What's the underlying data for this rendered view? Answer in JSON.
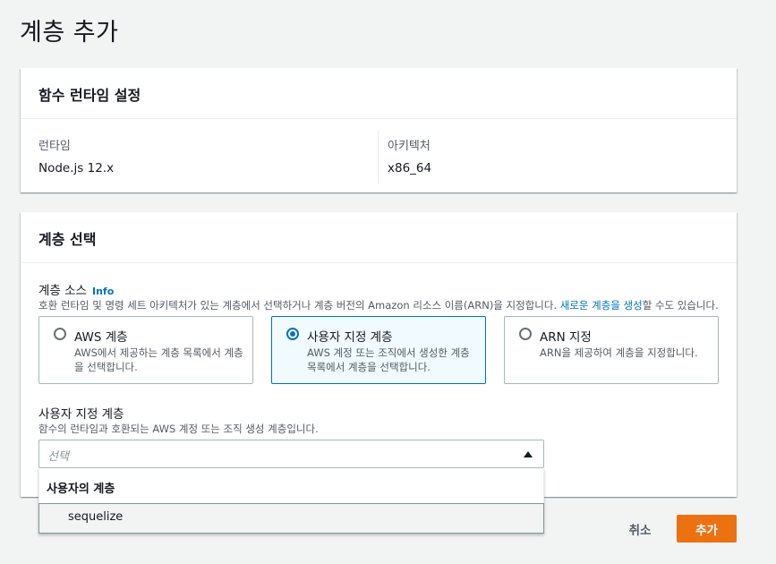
{
  "page": {
    "title": "계층 추가"
  },
  "runtime_panel": {
    "header": "함수 런타임 설정",
    "runtime_label": "런타임",
    "runtime_value": "Node.js 12.x",
    "arch_label": "아키텍처",
    "arch_value": "x86_64"
  },
  "layer_panel": {
    "header": "계층 선택",
    "source_label": "계층 소스",
    "info_link": "Info",
    "source_desc_before": "호환 런타임 및 명령 세트 아키텍처가 있는 계층에서 선택하거나 계층 버전의 Amazon 리소스 이름(ARN)을 지정합니다. ",
    "source_desc_link": "새로운 계층을 생성",
    "source_desc_after": "할 수도 있습니다.",
    "options": [
      {
        "title": "AWS 계층",
        "desc": "AWS에서 제공하는 계층 목록에서 계층을 선택합니다.",
        "selected": false
      },
      {
        "title": "사용자 지정 계층",
        "desc": "AWS 계정 또는 조직에서 생성한 계층 목록에서 계층을 선택합니다.",
        "selected": true
      },
      {
        "title": "ARN 지정",
        "desc": "ARN을 제공하여 계층을 지정합니다.",
        "selected": false
      }
    ],
    "custom_label": "사용자 지정 계층",
    "custom_desc": "함수의 런타임과 호환되는 AWS 계정 또는 조직 생성 계층입니다.",
    "select_placeholder": "선택"
  },
  "dropdown": {
    "group_label": "사용자의 계층",
    "options": [
      "sequelize"
    ]
  },
  "actions": {
    "cancel": "취소",
    "add": "추가"
  },
  "colors": {
    "accent": "#0073bb",
    "primary_button": "#ec7211",
    "background": "#f2f3f3"
  }
}
